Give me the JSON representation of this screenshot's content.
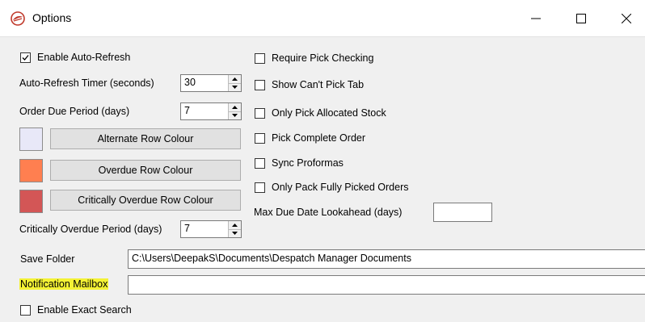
{
  "window": {
    "title": "Options",
    "app_icon": "app-logo-icon",
    "controls": {
      "minimize": "minimize-icon",
      "maximize": "maximize-icon",
      "close": "close-icon"
    }
  },
  "left": {
    "auto_refresh": {
      "label": "Enable Auto-Refresh",
      "checked": true
    },
    "timer": {
      "label": "Auto-Refresh Timer (seconds)",
      "value": "30"
    },
    "due_period": {
      "label": "Order Due Period (days)",
      "value": "7"
    },
    "colours": [
      {
        "button": "Alternate Row Colour",
        "swatch": "#e8e8f8"
      },
      {
        "button": "Overdue Row Colour",
        "swatch": "#ff7f50"
      },
      {
        "button": "Critically Overdue Row Colour",
        "swatch": "#d35656"
      }
    ],
    "critical_period": {
      "label": "Critically Overdue Period (days)",
      "value": "7"
    }
  },
  "right": {
    "checkboxes": [
      {
        "label": "Require Pick Checking",
        "checked": false
      },
      {
        "label": "Show Can't Pick Tab",
        "checked": false
      },
      {
        "label": "Only Pick Allocated Stock",
        "checked": false
      },
      {
        "label": "Pick Complete Order",
        "checked": false
      },
      {
        "label": "Sync Proformas",
        "checked": false
      },
      {
        "label": "Only Pack Fully Picked Orders",
        "checked": false
      }
    ],
    "lookahead": {
      "label": "Max Due Date Lookahead (days)",
      "value": ""
    }
  },
  "bottom": {
    "save_folder": {
      "label": "Save Folder",
      "value": "C:\\Users\\DeepakS\\Documents\\Despatch Manager Documents"
    },
    "mailbox": {
      "label": "Notification Mailbox",
      "value": "",
      "highlight_color": "#f4f235"
    },
    "exact_search": {
      "label": "Enable Exact Search",
      "checked": false
    }
  }
}
